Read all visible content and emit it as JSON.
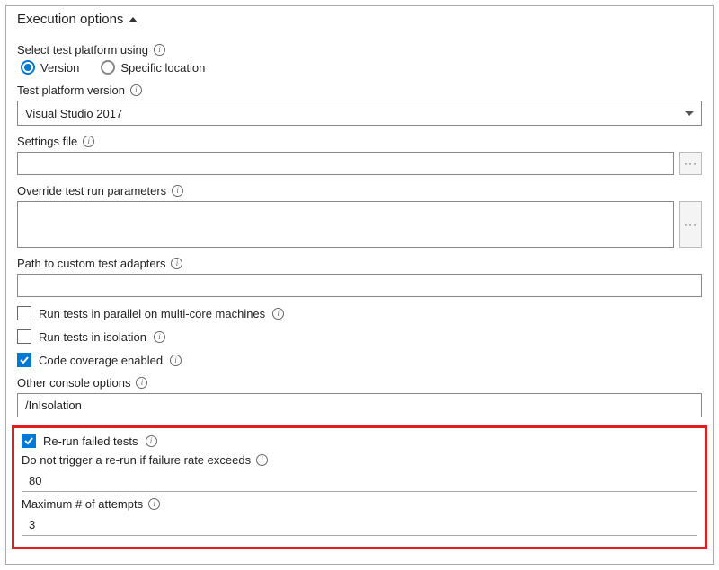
{
  "header": {
    "title": "Execution options"
  },
  "platformSelect": {
    "label": "Select test platform using",
    "options": {
      "version": "Version",
      "specific": "Specific location"
    },
    "selected": "version"
  },
  "platformVersion": {
    "label": "Test platform version",
    "value": "Visual Studio 2017"
  },
  "settingsFile": {
    "label": "Settings file",
    "value": ""
  },
  "overrideParams": {
    "label": "Override test run parameters",
    "value": ""
  },
  "customAdapters": {
    "label": "Path to custom test adapters",
    "value": ""
  },
  "parallel": {
    "label": "Run tests in parallel on multi-core machines",
    "checked": false
  },
  "isolation": {
    "label": "Run tests in isolation",
    "checked": false
  },
  "codeCoverage": {
    "label": "Code coverage enabled",
    "checked": true
  },
  "otherConsole": {
    "label": "Other console options",
    "value": "/InIsolation"
  },
  "rerun": {
    "label": "Re-run failed tests",
    "checked": true,
    "failureRate": {
      "label": "Do not trigger a re-run if failure rate exceeds",
      "value": "80"
    },
    "maxAttempts": {
      "label": "Maximum # of attempts",
      "value": "3"
    }
  }
}
